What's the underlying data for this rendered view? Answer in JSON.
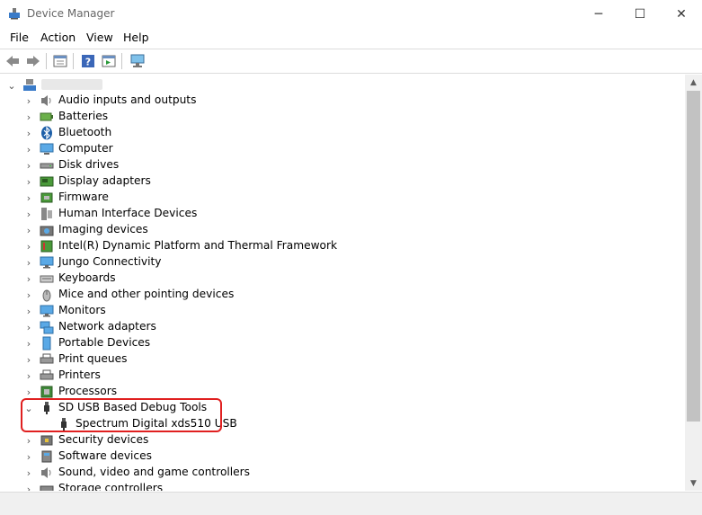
{
  "window": {
    "title": "Device Manager",
    "minimize_glyph": "─",
    "maximize_glyph": "☐",
    "close_glyph": "✕"
  },
  "menu": {
    "file": "File",
    "action": "Action",
    "view": "View",
    "help": "Help"
  },
  "toolbar": {
    "icons": [
      "back-icon",
      "forward-icon",
      "properties-icon",
      "help-icon",
      "details-icon",
      "scan-hardware-icon"
    ]
  },
  "tree": {
    "root_expander": "⌄",
    "collapsed_glyph": "›",
    "expanded_glyph": "⌄",
    "categories": [
      {
        "label": "Audio inputs and outputs",
        "icon": "speaker-icon"
      },
      {
        "label": "Batteries",
        "icon": "battery-icon"
      },
      {
        "label": "Bluetooth",
        "icon": "bluetooth-icon"
      },
      {
        "label": "Computer",
        "icon": "computer-icon"
      },
      {
        "label": "Disk drives",
        "icon": "disk-drive-icon"
      },
      {
        "label": "Display adapters",
        "icon": "display-adapter-icon"
      },
      {
        "label": "Firmware",
        "icon": "firmware-icon"
      },
      {
        "label": "Human Interface Devices",
        "icon": "hid-icon"
      },
      {
        "label": "Imaging devices",
        "icon": "camera-icon"
      },
      {
        "label": "Intel(R) Dynamic Platform and Thermal Framework",
        "icon": "thermal-icon"
      },
      {
        "label": "Jungo Connectivity",
        "icon": "monitor-icon"
      },
      {
        "label": "Keyboards",
        "icon": "keyboard-icon"
      },
      {
        "label": "Mice and other pointing devices",
        "icon": "mouse-icon"
      },
      {
        "label": "Monitors",
        "icon": "monitor-icon"
      },
      {
        "label": "Network adapters",
        "icon": "network-icon"
      },
      {
        "label": "Portable Devices",
        "icon": "portable-device-icon"
      },
      {
        "label": "Print queues",
        "icon": "printer-icon"
      },
      {
        "label": "Printers",
        "icon": "printer-icon"
      },
      {
        "label": "Processors",
        "icon": "processor-icon"
      },
      {
        "label": "SD USB Based Debug Tools",
        "icon": "usb-plug-icon",
        "expanded": true
      },
      {
        "label": "Spectrum Digital xds510 USB",
        "icon": "usb-plug-icon",
        "child": true
      },
      {
        "label": "Security devices",
        "icon": "security-icon"
      },
      {
        "label": "Software devices",
        "icon": "software-device-icon"
      },
      {
        "label": "Sound, video and game controllers",
        "icon": "speaker-icon"
      },
      {
        "label": "Storage controllers",
        "icon": "storage-icon"
      }
    ]
  },
  "colors": {
    "highlight_border": "#e02020",
    "icon_blue": "#2a7fd4"
  }
}
